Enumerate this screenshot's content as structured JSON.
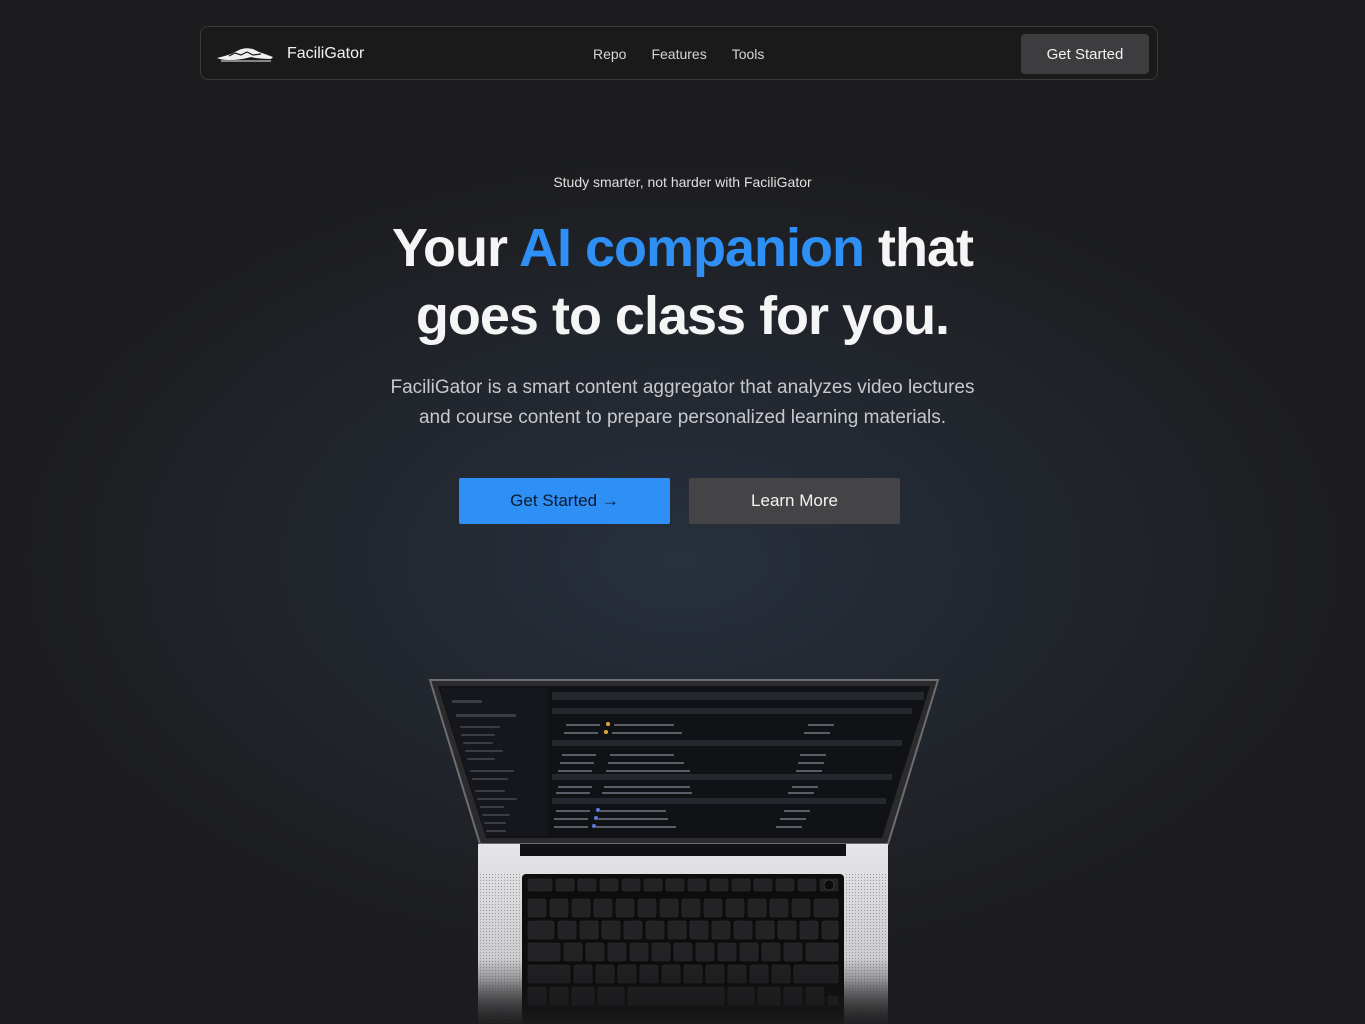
{
  "nav": {
    "brand_name": "FaciliGator",
    "links": [
      "Repo",
      "Features",
      "Tools"
    ],
    "cta_label": "Get Started"
  },
  "hero": {
    "tagline": "Study smarter, not harder with FaciliGator",
    "headline_part1": "Your ",
    "headline_accent": "AI companion",
    "headline_part2": " that",
    "headline_line2": "goes to class for you.",
    "lead_line1": "FaciliGator is a smart content aggregator that analyzes video lectures",
    "lead_line2": "and course content to prepare personalized learning materials.",
    "primary_cta": "Get Started →",
    "secondary_cta": "Learn More"
  },
  "theme": {
    "accent": "#2e8ff5",
    "background": "#1c1c1e",
    "nav_button": "#3d3d3f",
    "secondary_button": "#444446"
  },
  "icons": {
    "brand": "gator-logo-icon",
    "laptop": "laptop-illustration"
  }
}
